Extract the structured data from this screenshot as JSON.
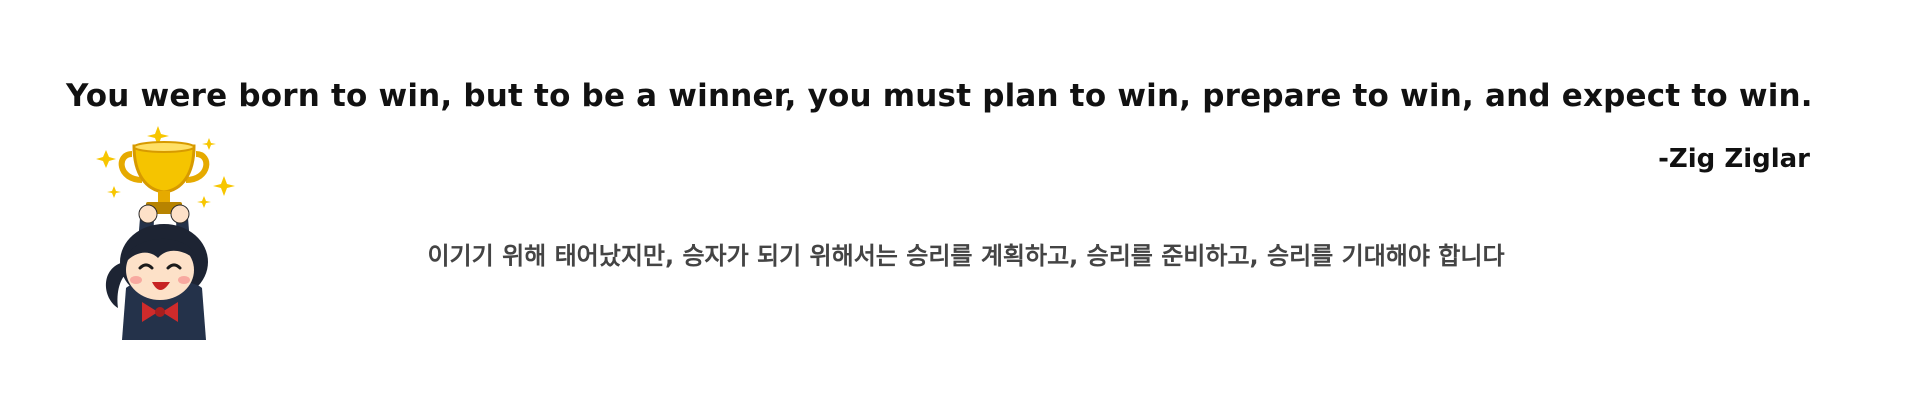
{
  "quote": {
    "english": "You were born to win, but to be a winner, you must plan to win, prepare to win, and expect to win.",
    "author": "-Zig Ziglar",
    "korean": "이기기 위해 태어났지만, 승자가 되기 위해서는 승리를 계획하고, 승리를 준비하고, 승리를 기대해야 합니다"
  },
  "illustration": {
    "icon": "girl-holding-trophy-illustration",
    "colors": {
      "trophy": "#f5c400",
      "sparkle": "#f7c600",
      "hair": "#1d2433",
      "uniform": "#24324a",
      "bow": "#cf2b2b",
      "skin": "#fde1c8"
    }
  }
}
